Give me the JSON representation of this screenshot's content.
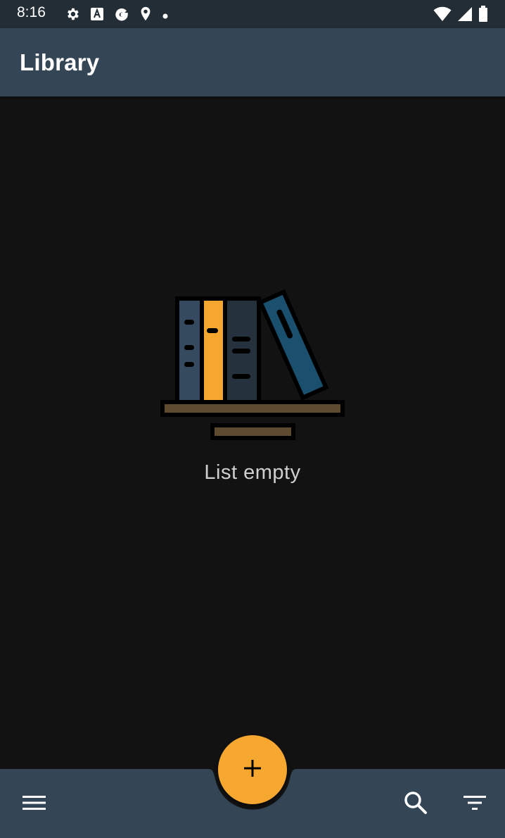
{
  "status_bar": {
    "time": "8:16",
    "icons": [
      "gear-icon",
      "translate-icon",
      "google-icon",
      "location-icon",
      "dot-icon"
    ],
    "right_icons": [
      "wifi-icon",
      "signal-icon",
      "battery-icon"
    ]
  },
  "app_bar": {
    "title": "Library"
  },
  "empty_state": {
    "message": "List empty",
    "illustration": "books-on-shelf"
  },
  "bottom_bar": {
    "menu_icon": "menu-icon",
    "search_icon": "search-icon",
    "filter_icon": "filter-icon"
  },
  "fab": {
    "icon": "plus-icon"
  },
  "colors": {
    "status_bar": "#232d36",
    "app_bar": "#344656",
    "background": "#121212",
    "accent": "#f5a730",
    "book_blue": "#1a4f6e",
    "shelf": "#5e4a2e"
  }
}
